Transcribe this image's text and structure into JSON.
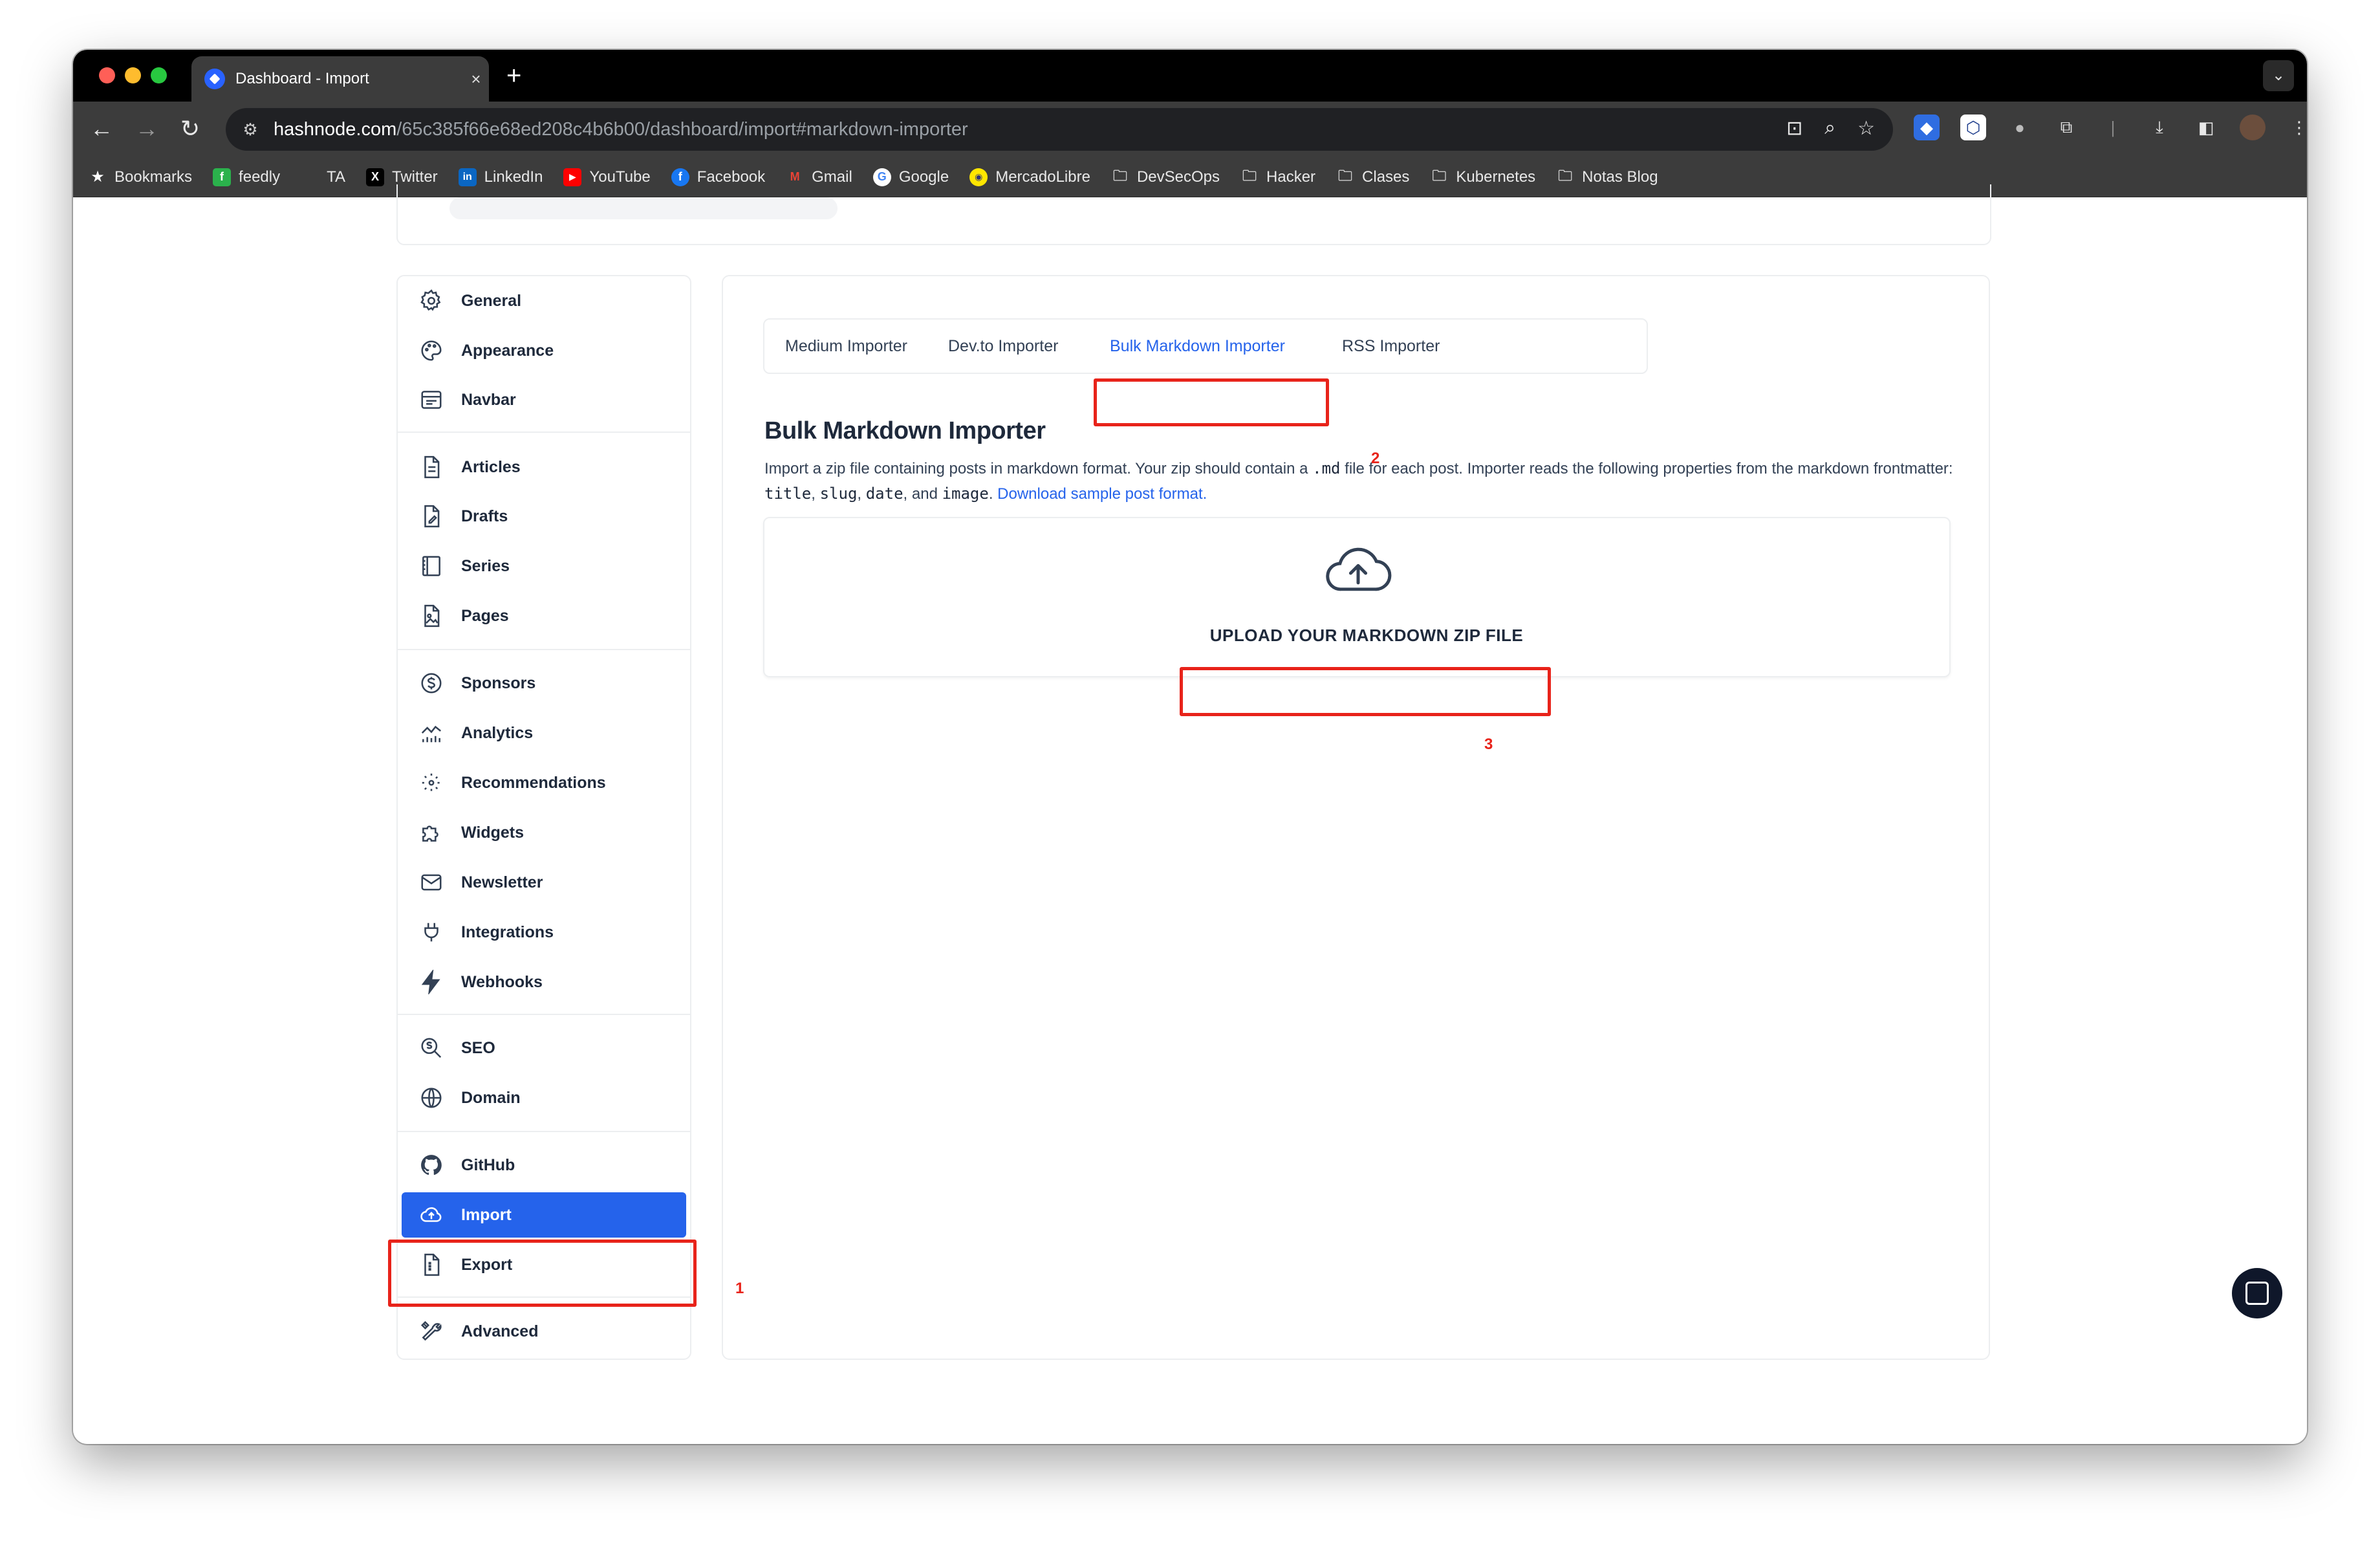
{
  "browser": {
    "tab_title": "Dashboard - Import",
    "tab_close": "×",
    "new_tab": "+",
    "url_host": "hashnode.com",
    "url_path": "/65c385f66e68ed208c4b6b00/dashboard/import#markdown-importer"
  },
  "bookmarks": [
    {
      "label": "Bookmarks",
      "icon": "star-icon"
    },
    {
      "label": "feedly",
      "icon": "feedly-icon"
    },
    {
      "label": "TA",
      "icon": "blank-icon"
    },
    {
      "label": "Twitter",
      "icon": "x-icon"
    },
    {
      "label": "LinkedIn",
      "icon": "linkedin-icon"
    },
    {
      "label": "YouTube",
      "icon": "youtube-icon"
    },
    {
      "label": "Facebook",
      "icon": "facebook-icon"
    },
    {
      "label": "Gmail",
      "icon": "gmail-icon"
    },
    {
      "label": "Google",
      "icon": "google-icon"
    },
    {
      "label": "MercadoLibre",
      "icon": "mercadolibre-icon"
    },
    {
      "label": "DevSecOps",
      "icon": "folder-icon"
    },
    {
      "label": "Hacker",
      "icon": "folder-icon"
    },
    {
      "label": "Clases",
      "icon": "folder-icon"
    },
    {
      "label": "Kubernetes",
      "icon": "folder-icon"
    },
    {
      "label": "Notas Blog",
      "icon": "folder-icon"
    }
  ],
  "sidebar": {
    "items": [
      {
        "label": "General",
        "icon": "gear-icon"
      },
      {
        "label": "Appearance",
        "icon": "palette-icon"
      },
      {
        "label": "Navbar",
        "icon": "navbar-icon"
      },
      {
        "label": "Articles",
        "icon": "document-icon"
      },
      {
        "label": "Drafts",
        "icon": "draft-icon"
      },
      {
        "label": "Series",
        "icon": "book-icon"
      },
      {
        "label": "Pages",
        "icon": "page-icon"
      },
      {
        "label": "Sponsors",
        "icon": "dollar-icon"
      },
      {
        "label": "Analytics",
        "icon": "chart-icon"
      },
      {
        "label": "Recommendations",
        "icon": "recommend-icon"
      },
      {
        "label": "Widgets",
        "icon": "puzzle-icon"
      },
      {
        "label": "Newsletter",
        "icon": "mail-icon"
      },
      {
        "label": "Integrations",
        "icon": "plug-icon"
      },
      {
        "label": "Webhooks",
        "icon": "bolt-icon"
      },
      {
        "label": "SEO",
        "icon": "seo-icon"
      },
      {
        "label": "Domain",
        "icon": "globe-icon"
      },
      {
        "label": "GitHub",
        "icon": "github-icon"
      },
      {
        "label": "Import",
        "icon": "cloud-upload-icon"
      },
      {
        "label": "Export",
        "icon": "export-icon"
      },
      {
        "label": "Advanced",
        "icon": "tools-icon"
      }
    ],
    "active": "Import"
  },
  "main": {
    "tabs": [
      {
        "label": "Medium Importer"
      },
      {
        "label": "Dev.to Importer"
      },
      {
        "label": "Bulk Markdown Importer"
      },
      {
        "label": "RSS Importer"
      }
    ],
    "active_tab": "Bulk Markdown Importer",
    "title": "Bulk Markdown Importer",
    "desc_part1": "Import a zip file containing posts in markdown format. Your zip should contain a ",
    "desc_code_md": ".md",
    "desc_part2": " file for each post. Importer reads the following properties from the markdown frontmatter: ",
    "desc_code_title": "title",
    "desc_sep1": ", ",
    "desc_code_slug": "slug",
    "desc_sep2": ", ",
    "desc_code_date": "date",
    "desc_sep3": ", and ",
    "desc_code_image": "image",
    "desc_sep4": ". ",
    "desc_link": "Download sample post format.",
    "upload_label": "UPLOAD YOUR MARKDOWN ZIP FILE"
  },
  "annotations": {
    "n1": "1",
    "n2": "2",
    "n3": "3",
    "color": "#e8231a"
  },
  "colors": {
    "accent": "#2563eb",
    "text": "#1e293b"
  }
}
